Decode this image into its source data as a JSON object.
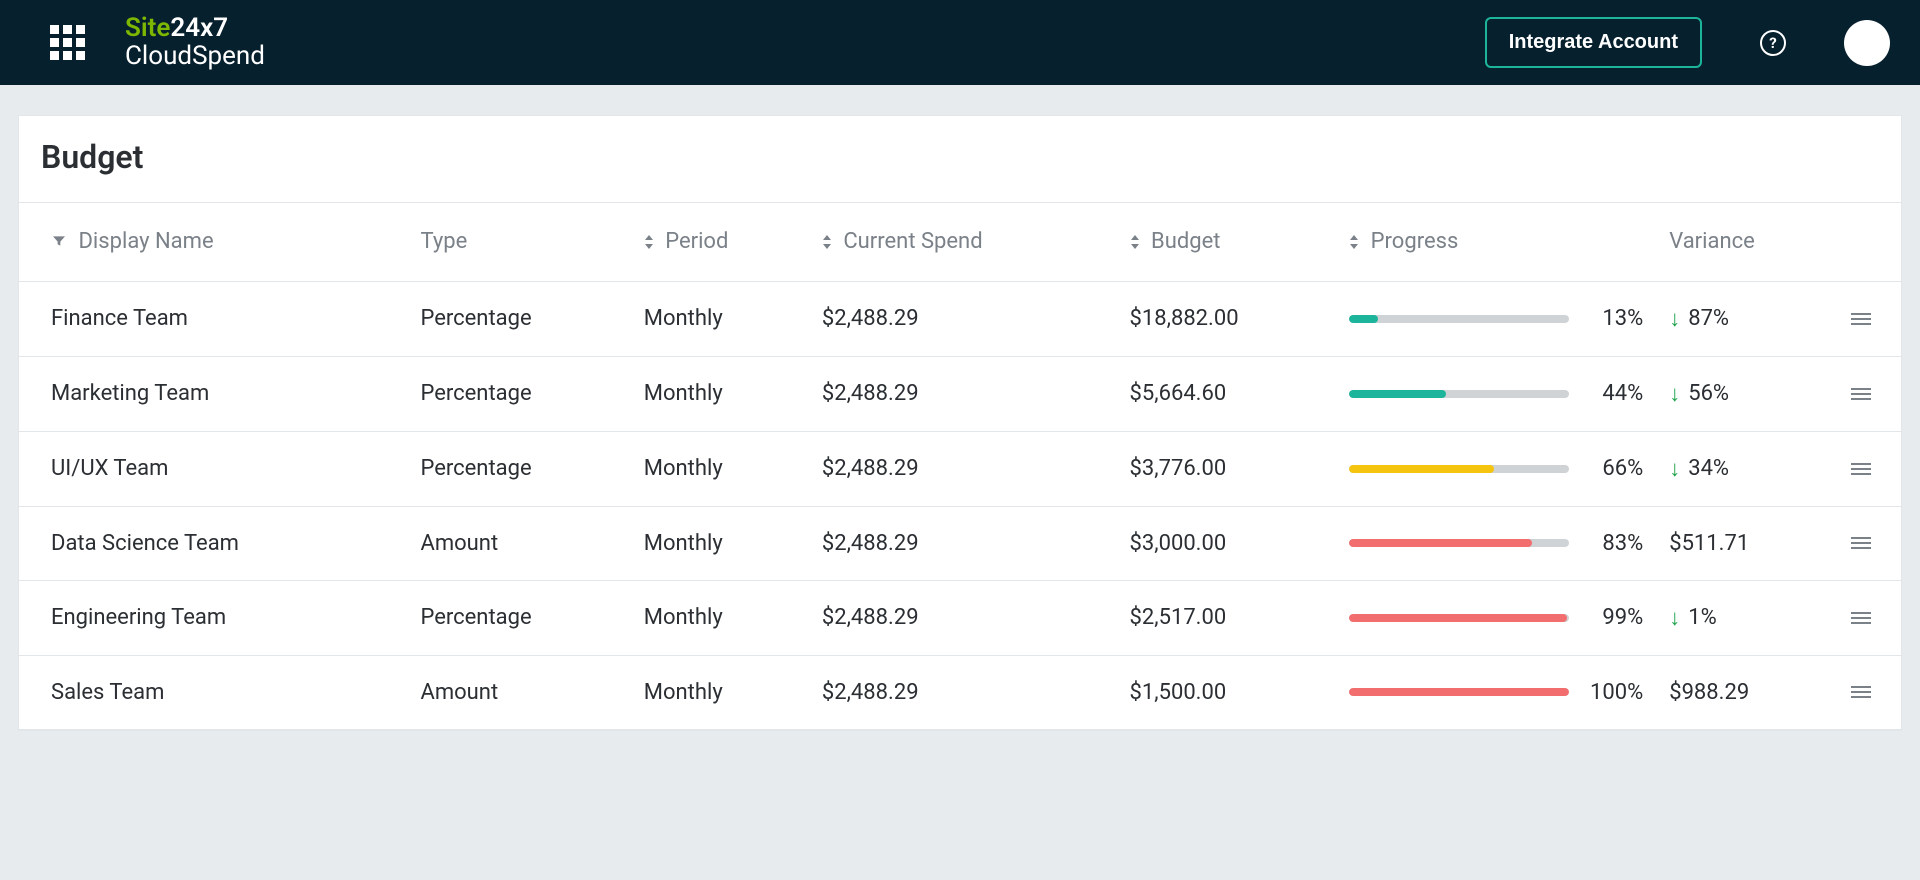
{
  "header": {
    "brand_line1_a": "Site",
    "brand_line1_b": "24x7",
    "brand_line2": "CloudSpend",
    "integrate_label": "Integrate Account",
    "help_label": "?"
  },
  "page": {
    "title": "Budget"
  },
  "columns": {
    "display_name": "Display Name",
    "type": "Type",
    "period": "Period",
    "current_spend": "Current Spend",
    "budget": "Budget",
    "progress": "Progress",
    "variance": "Variance"
  },
  "rows": [
    {
      "display_name": "Finance Team",
      "type": "Percentage",
      "period": "Monthly",
      "current_spend": "$2,488.29",
      "budget": "$18,882.00",
      "progress_pct": 13,
      "progress_label": "13%",
      "progress_color": "teal",
      "variance_label": "87%",
      "variance_arrow": true
    },
    {
      "display_name": "Marketing Team",
      "type": "Percentage",
      "period": "Monthly",
      "current_spend": "$2,488.29",
      "budget": "$5,664.60",
      "progress_pct": 44,
      "progress_label": "44%",
      "progress_color": "teal",
      "variance_label": "56%",
      "variance_arrow": true
    },
    {
      "display_name": "UI/UX Team",
      "type": "Percentage",
      "period": "Monthly",
      "current_spend": "$2,488.29",
      "budget": "$3,776.00",
      "progress_pct": 66,
      "progress_label": "66%",
      "progress_color": "yellow",
      "variance_label": "34%",
      "variance_arrow": true
    },
    {
      "display_name": "Data Science Team",
      "type": "Amount",
      "period": "Monthly",
      "current_spend": "$2,488.29",
      "budget": "$3,000.00",
      "progress_pct": 83,
      "progress_label": "83%",
      "progress_color": "red",
      "variance_label": "$511.71",
      "variance_arrow": false
    },
    {
      "display_name": "Engineering Team",
      "type": "Percentage",
      "period": "Monthly",
      "current_spend": "$2,488.29",
      "budget": "$2,517.00",
      "progress_pct": 99,
      "progress_label": "99%",
      "progress_color": "red",
      "variance_label": "1%",
      "variance_arrow": true
    },
    {
      "display_name": "Sales Team",
      "type": "Amount",
      "period": "Monthly",
      "current_spend": "$2,488.29",
      "budget": "$1,500.00",
      "progress_pct": 100,
      "progress_label": "100%",
      "progress_color": "red",
      "variance_label": "$988.29",
      "variance_arrow": false
    }
  ]
}
